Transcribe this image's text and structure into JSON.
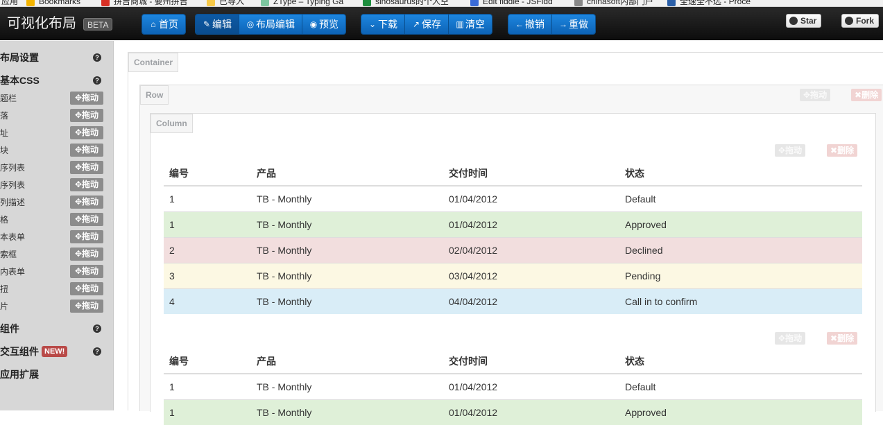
{
  "bookmarks": [
    {
      "label": "应用",
      "color": "#4285f4"
    },
    {
      "label": "Bookmarks",
      "color": "#f4b400"
    },
    {
      "label": "拼吉商城 - 要州拼吉",
      "color": "#d93025"
    },
    {
      "label": "已导入",
      "color": "#f7c948"
    },
    {
      "label": "ZType – Typing Ga",
      "color": "#7cc7a0"
    },
    {
      "label": "sinosaurus的个人空",
      "color": "#1e8e3e"
    },
    {
      "label": "Edit fiddle - JSFidd",
      "color": "#3a6bd8"
    },
    {
      "label": "chinasoft内部门户",
      "color": "#888888"
    },
    {
      "label": "全速全不远 - Proce",
      "color": "#2a5fa8"
    }
  ],
  "navbar": {
    "brand": "可视化布局",
    "beta": "BETA",
    "home": "首页",
    "edit": "编辑",
    "layout_edit": "布局编辑",
    "preview": "预览",
    "download": "下载",
    "save": "保存",
    "clear": "清空",
    "undo": "撤销",
    "redo": "重做",
    "star": "Star",
    "fork": "Fork"
  },
  "sidebar": {
    "sections": {
      "layout": "布局设置",
      "basic_css": "基本CSS",
      "components": "组件",
      "interactive": "交互组件",
      "new_badge": "NEW!",
      "extensions": "应用扩展"
    },
    "drag_label": "拖动",
    "items": [
      "题栏",
      "落",
      "址",
      "块",
      "序列表",
      "序列表",
      "列描述",
      "格",
      "本表单",
      "索框",
      "内表单",
      "扭",
      "片"
    ]
  },
  "canvas": {
    "container_tag": "Container",
    "row_tag": "Row",
    "column_tag": "Column",
    "drag_label": "拖动",
    "delete_label": "删除",
    "table1": {
      "headers": [
        "编号",
        "产品",
        "交付时间",
        "状态"
      ],
      "rows": [
        {
          "style": "",
          "cells": [
            "1",
            "TB - Monthly",
            "01/04/2012",
            "Default"
          ]
        },
        {
          "style": "success",
          "cells": [
            "1",
            "TB - Monthly",
            "01/04/2012",
            "Approved"
          ]
        },
        {
          "style": "error",
          "cells": [
            "2",
            "TB - Monthly",
            "02/04/2012",
            "Declined"
          ]
        },
        {
          "style": "warning",
          "cells": [
            "3",
            "TB - Monthly",
            "03/04/2012",
            "Pending"
          ]
        },
        {
          "style": "info",
          "cells": [
            "4",
            "TB - Monthly",
            "04/04/2012",
            "Call in to confirm"
          ]
        }
      ]
    },
    "table2": {
      "headers": [
        "编号",
        "产品",
        "交付时间",
        "状态"
      ],
      "rows": [
        {
          "style": "",
          "cells": [
            "1",
            "TB - Monthly",
            "01/04/2012",
            "Default"
          ]
        },
        {
          "style": "success",
          "cells": [
            "1",
            "TB - Monthly",
            "01/04/2012",
            "Approved"
          ]
        }
      ]
    }
  }
}
